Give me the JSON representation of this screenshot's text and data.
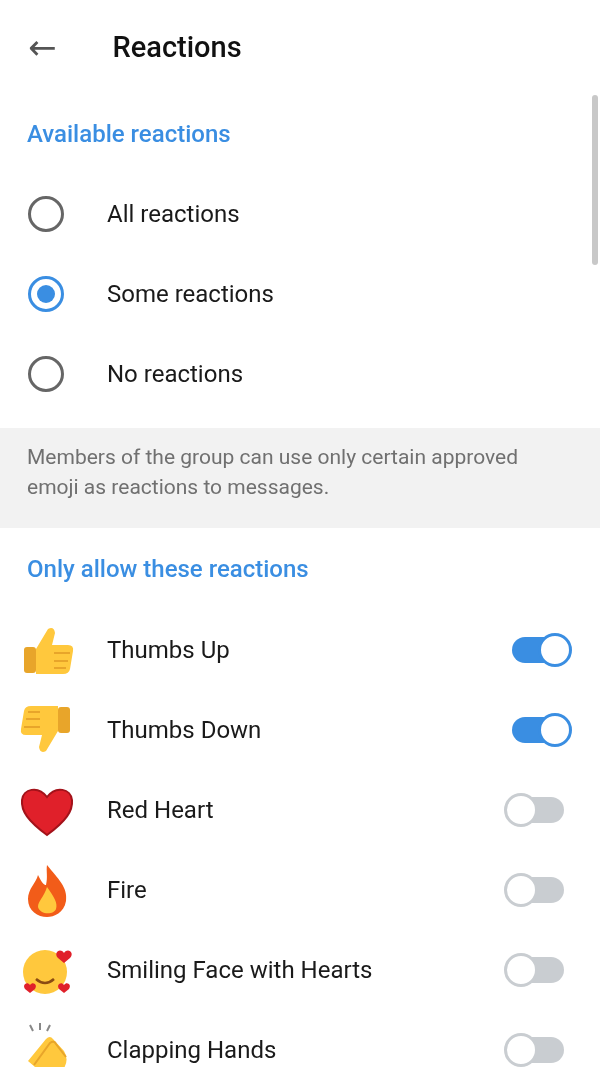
{
  "header": {
    "back_icon": "←",
    "title": "Reactions"
  },
  "available": {
    "heading": "Available reactions",
    "options": [
      {
        "label": "All reactions",
        "selected": false
      },
      {
        "label": "Some reactions",
        "selected": true
      },
      {
        "label": "No reactions",
        "selected": false
      }
    ],
    "info": "Members of the group can use only certain approved emoji as reactions to messages."
  },
  "allowed": {
    "heading": "Only allow these reactions",
    "items": [
      {
        "label": "Thumbs Up",
        "on": true
      },
      {
        "label": "Thumbs Down",
        "on": true
      },
      {
        "label": "Red Heart",
        "on": false
      },
      {
        "label": "Fire",
        "on": false
      },
      {
        "label": "Smiling Face with Hearts",
        "on": false
      },
      {
        "label": "Clapping Hands",
        "on": false
      }
    ]
  }
}
